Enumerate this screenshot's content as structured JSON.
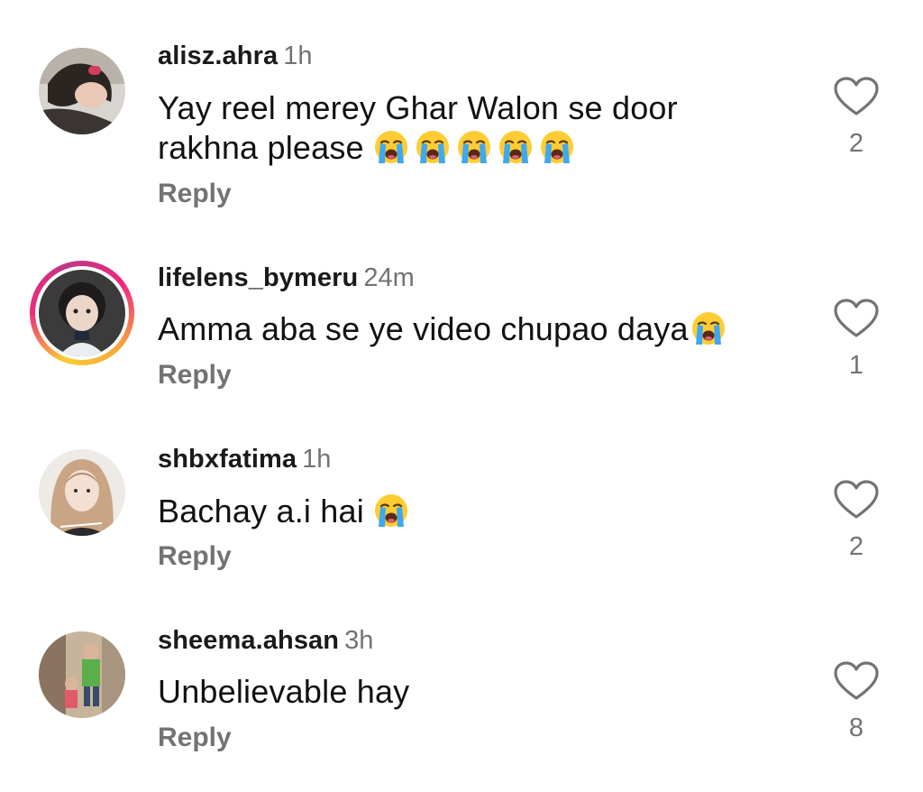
{
  "comments": [
    {
      "username": "alisz.ahra",
      "time": "1h",
      "text": "Yay reel merey Ghar Walon se door",
      "text_line2": "rakhna please",
      "emoji_count": 5,
      "reply_label": "Reply",
      "likes": "2",
      "has_story_ring": false
    },
    {
      "username": "lifelens_bymeru",
      "time": "24m",
      "text": "Amma aba se ye video chupao daya",
      "emoji_count": 1,
      "reply_label": "Reply",
      "likes": "1",
      "has_story_ring": true
    },
    {
      "username": "shbxfatima",
      "time": "1h",
      "text": "Bachay a.i hai",
      "emoji_count": 1,
      "reply_label": "Reply",
      "likes": "2",
      "has_story_ring": false
    },
    {
      "username": "sheema.ahsan",
      "time": "3h",
      "text": "Unbelievable hay",
      "emoji_count": 0,
      "reply_label": "Reply",
      "likes": "8",
      "has_story_ring": false
    }
  ],
  "icons": {
    "like": "heart-outline-icon",
    "emoji": "loudly-crying-face-emoji"
  },
  "colors": {
    "secondary_text": "#737373",
    "primary_text": "#111111",
    "story_ring": "#ee2a7b"
  }
}
